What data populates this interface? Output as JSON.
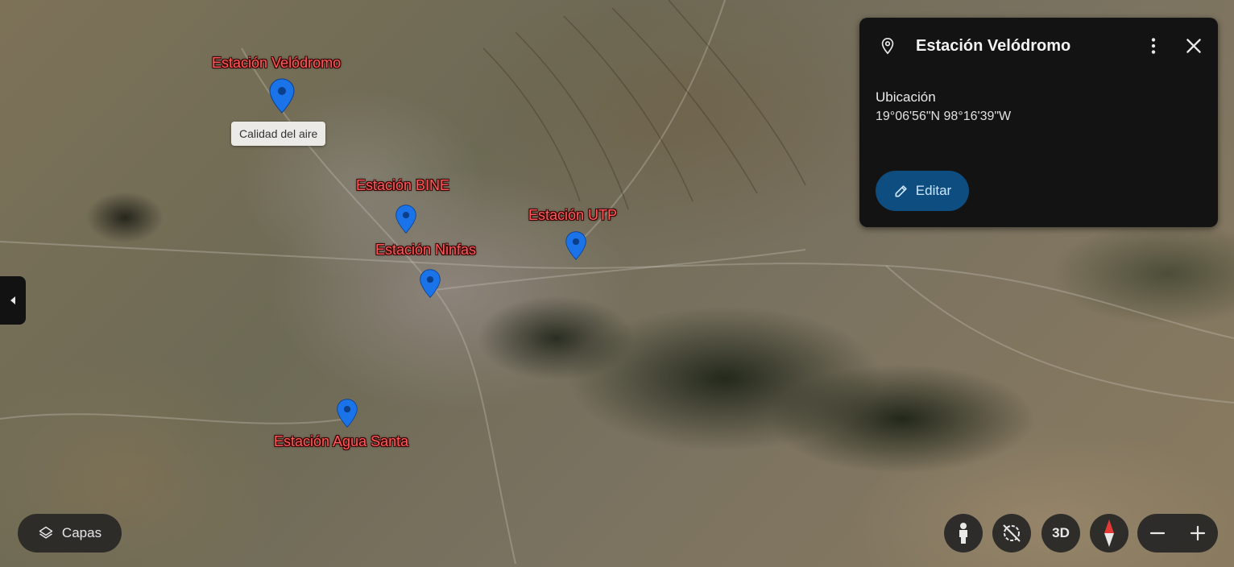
{
  "map": {
    "places": [
      {
        "label": "Estación Velódromo"
      },
      {
        "label": "Estación BINE"
      },
      {
        "label": "Estación Ninfas"
      },
      {
        "label": "Estación UTP"
      },
      {
        "label": "Estación Agua Santa"
      }
    ],
    "tooltip": "Calidad del aire",
    "marker_color": "#1a73e8"
  },
  "panel": {
    "title": "Estación Velódromo",
    "location_label": "Ubicación",
    "coordinates": "19°06'56\"N 98°16'39\"W",
    "edit_label": "Editar",
    "icons": [
      "location-pin-icon",
      "more-vert-icon",
      "close-icon",
      "pencil-icon"
    ]
  },
  "controls": {
    "layers_label": "Capas",
    "view_3d_label": "3D",
    "icons": [
      "layers-icon",
      "street-view-pegman-icon",
      "tilt-off-icon",
      "compass-icon",
      "zoom-out-icon",
      "zoom-in-icon",
      "collapse-arrow-icon"
    ]
  }
}
